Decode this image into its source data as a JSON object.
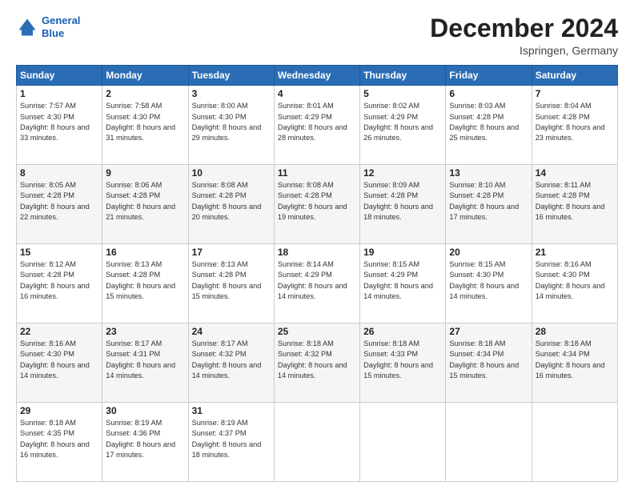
{
  "logo": {
    "line1": "General",
    "line2": "Blue"
  },
  "header": {
    "title": "December 2024",
    "location": "Ispringen, Germany"
  },
  "weekdays": [
    "Sunday",
    "Monday",
    "Tuesday",
    "Wednesday",
    "Thursday",
    "Friday",
    "Saturday"
  ],
  "weeks": [
    [
      {
        "day": "1",
        "sunrise": "7:57 AM",
        "sunset": "4:30 PM",
        "daylight": "8 hours and 33 minutes."
      },
      {
        "day": "2",
        "sunrise": "7:58 AM",
        "sunset": "4:30 PM",
        "daylight": "8 hours and 31 minutes."
      },
      {
        "day": "3",
        "sunrise": "8:00 AM",
        "sunset": "4:30 PM",
        "daylight": "8 hours and 29 minutes."
      },
      {
        "day": "4",
        "sunrise": "8:01 AM",
        "sunset": "4:29 PM",
        "daylight": "8 hours and 28 minutes."
      },
      {
        "day": "5",
        "sunrise": "8:02 AM",
        "sunset": "4:29 PM",
        "daylight": "8 hours and 26 minutes."
      },
      {
        "day": "6",
        "sunrise": "8:03 AM",
        "sunset": "4:28 PM",
        "daylight": "8 hours and 25 minutes."
      },
      {
        "day": "7",
        "sunrise": "8:04 AM",
        "sunset": "4:28 PM",
        "daylight": "8 hours and 23 minutes."
      }
    ],
    [
      {
        "day": "8",
        "sunrise": "8:05 AM",
        "sunset": "4:28 PM",
        "daylight": "8 hours and 22 minutes."
      },
      {
        "day": "9",
        "sunrise": "8:06 AM",
        "sunset": "4:28 PM",
        "daylight": "8 hours and 21 minutes."
      },
      {
        "day": "10",
        "sunrise": "8:08 AM",
        "sunset": "4:28 PM",
        "daylight": "8 hours and 20 minutes."
      },
      {
        "day": "11",
        "sunrise": "8:08 AM",
        "sunset": "4:28 PM",
        "daylight": "8 hours and 19 minutes."
      },
      {
        "day": "12",
        "sunrise": "8:09 AM",
        "sunset": "4:28 PM",
        "daylight": "8 hours and 18 minutes."
      },
      {
        "day": "13",
        "sunrise": "8:10 AM",
        "sunset": "4:28 PM",
        "daylight": "8 hours and 17 minutes."
      },
      {
        "day": "14",
        "sunrise": "8:11 AM",
        "sunset": "4:28 PM",
        "daylight": "8 hours and 16 minutes."
      }
    ],
    [
      {
        "day": "15",
        "sunrise": "8:12 AM",
        "sunset": "4:28 PM",
        "daylight": "8 hours and 16 minutes."
      },
      {
        "day": "16",
        "sunrise": "8:13 AM",
        "sunset": "4:28 PM",
        "daylight": "8 hours and 15 minutes."
      },
      {
        "day": "17",
        "sunrise": "8:13 AM",
        "sunset": "4:28 PM",
        "daylight": "8 hours and 15 minutes."
      },
      {
        "day": "18",
        "sunrise": "8:14 AM",
        "sunset": "4:29 PM",
        "daylight": "8 hours and 14 minutes."
      },
      {
        "day": "19",
        "sunrise": "8:15 AM",
        "sunset": "4:29 PM",
        "daylight": "8 hours and 14 minutes."
      },
      {
        "day": "20",
        "sunrise": "8:15 AM",
        "sunset": "4:30 PM",
        "daylight": "8 hours and 14 minutes."
      },
      {
        "day": "21",
        "sunrise": "8:16 AM",
        "sunset": "4:30 PM",
        "daylight": "8 hours and 14 minutes."
      }
    ],
    [
      {
        "day": "22",
        "sunrise": "8:16 AM",
        "sunset": "4:30 PM",
        "daylight": "8 hours and 14 minutes."
      },
      {
        "day": "23",
        "sunrise": "8:17 AM",
        "sunset": "4:31 PM",
        "daylight": "8 hours and 14 minutes."
      },
      {
        "day": "24",
        "sunrise": "8:17 AM",
        "sunset": "4:32 PM",
        "daylight": "8 hours and 14 minutes."
      },
      {
        "day": "25",
        "sunrise": "8:18 AM",
        "sunset": "4:32 PM",
        "daylight": "8 hours and 14 minutes."
      },
      {
        "day": "26",
        "sunrise": "8:18 AM",
        "sunset": "4:33 PM",
        "daylight": "8 hours and 15 minutes."
      },
      {
        "day": "27",
        "sunrise": "8:18 AM",
        "sunset": "4:34 PM",
        "daylight": "8 hours and 15 minutes."
      },
      {
        "day": "28",
        "sunrise": "8:18 AM",
        "sunset": "4:34 PM",
        "daylight": "8 hours and 16 minutes."
      }
    ],
    [
      {
        "day": "29",
        "sunrise": "8:18 AM",
        "sunset": "4:35 PM",
        "daylight": "8 hours and 16 minutes."
      },
      {
        "day": "30",
        "sunrise": "8:19 AM",
        "sunset": "4:36 PM",
        "daylight": "8 hours and 17 minutes."
      },
      {
        "day": "31",
        "sunrise": "8:19 AM",
        "sunset": "4:37 PM",
        "daylight": "8 hours and 18 minutes."
      },
      null,
      null,
      null,
      null
    ]
  ],
  "labels": {
    "sunrise": "Sunrise:",
    "sunset": "Sunset:",
    "daylight": "Daylight:"
  }
}
